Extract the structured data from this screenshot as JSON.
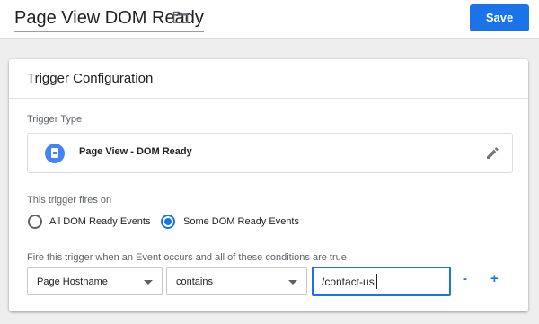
{
  "header": {
    "title": "Page View DOM Ready",
    "folder_icon": "folder-icon",
    "save_label": "Save"
  },
  "card": {
    "title": "Trigger Configuration",
    "trigger_type_label": "Trigger Type",
    "trigger_type": {
      "icon": "document-icon",
      "name": "Page View - DOM Ready",
      "edit_icon": "pencil-icon"
    },
    "fires_on_label": "This trigger fires on",
    "radio_options": [
      {
        "label": "All DOM Ready Events",
        "checked": false
      },
      {
        "label": "Some DOM Ready Events",
        "checked": true
      }
    ],
    "condition_label": "Fire this trigger when an Event occurs and all of these conditions are true",
    "condition": {
      "variable": "Page Hostname",
      "operator": "contains",
      "value": "/contact-us",
      "remove_label": "-",
      "add_label": "+"
    }
  },
  "colors": {
    "accent": "#1a73e8",
    "icon_blue": "#4285f4"
  }
}
